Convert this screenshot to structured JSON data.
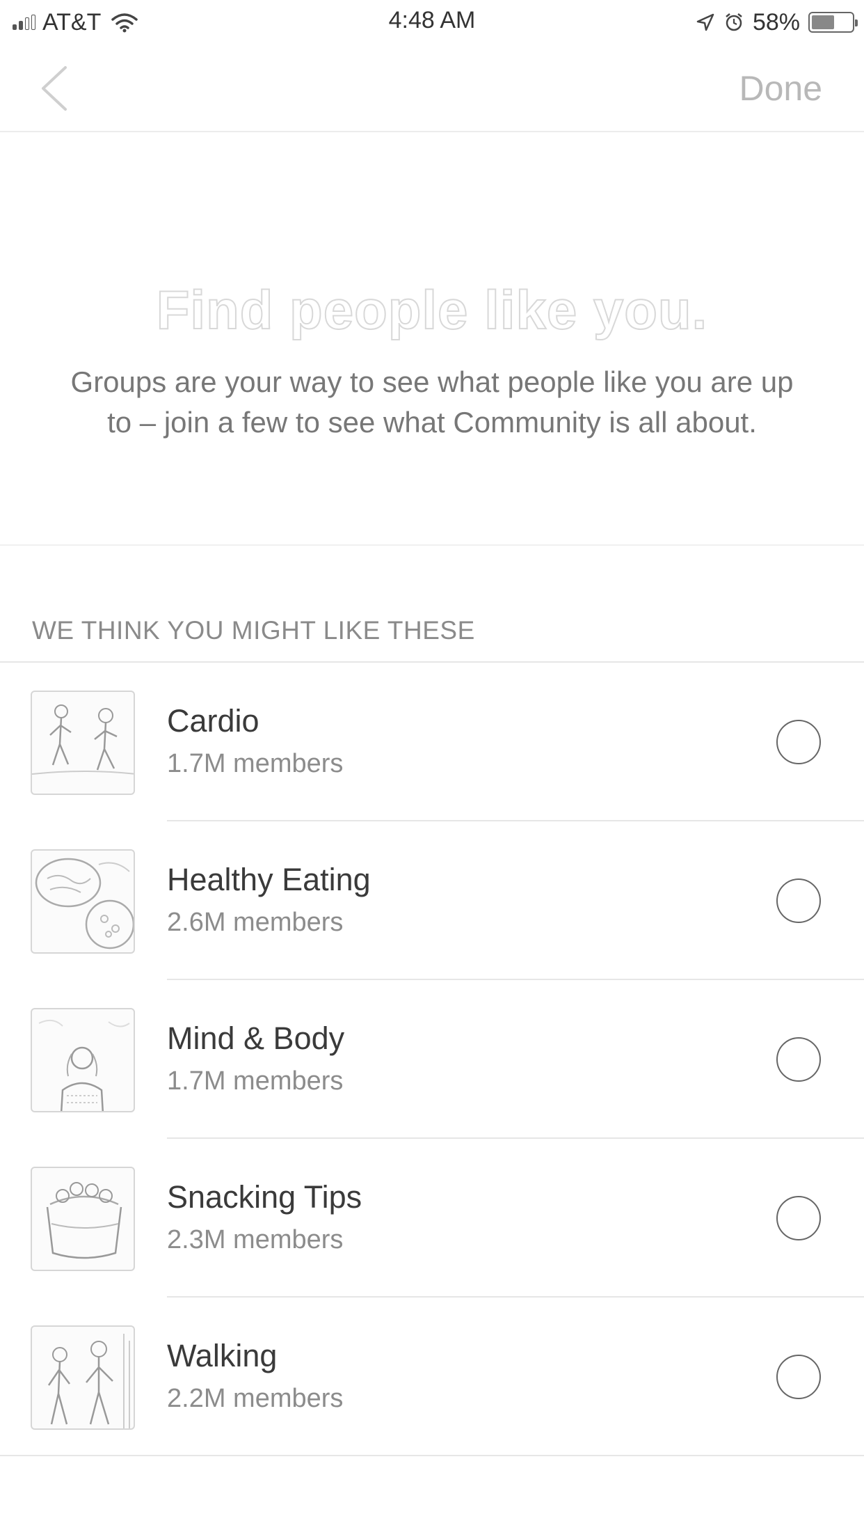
{
  "status_bar": {
    "carrier": "AT&T",
    "time": "4:48 AM",
    "battery_percent": "58%",
    "battery_level": 0.58,
    "signal_bars_filled": 2,
    "signal_bars_total": 4,
    "icons": [
      "signal-icon",
      "wifi-icon",
      "location-arrow-icon",
      "alarm-icon",
      "battery-icon"
    ]
  },
  "nav": {
    "back_icon": "chevron-left-icon",
    "done_label": "Done"
  },
  "hero": {
    "title": "Find people like you.",
    "subtitle": "Groups are your way to see what people like you are up to – join a few to see what Community is all about."
  },
  "section": {
    "header": "WE THINK YOU MIGHT LIKE THESE"
  },
  "groups": [
    {
      "name": "Cardio",
      "members": "1.7M members",
      "thumbnail": "runners-photo",
      "selected": false
    },
    {
      "name": "Healthy Eating",
      "members": "2.6M members",
      "thumbnail": "salad-bowls-photo",
      "selected": false
    },
    {
      "name": "Mind & Body",
      "members": "1.7M members",
      "thumbnail": "meditation-photo",
      "selected": false
    },
    {
      "name": "Snacking Tips",
      "members": "2.3M members",
      "thumbnail": "snack-jar-photo",
      "selected": false
    },
    {
      "name": "Walking",
      "members": "2.2M members",
      "thumbnail": "walkers-photo",
      "selected": false
    }
  ],
  "colors": {
    "text_primary": "#3a3a3a",
    "text_secondary": "#8c8c8c",
    "done_disabled": "#b8b8b8",
    "divider": "#e6e6e6"
  }
}
